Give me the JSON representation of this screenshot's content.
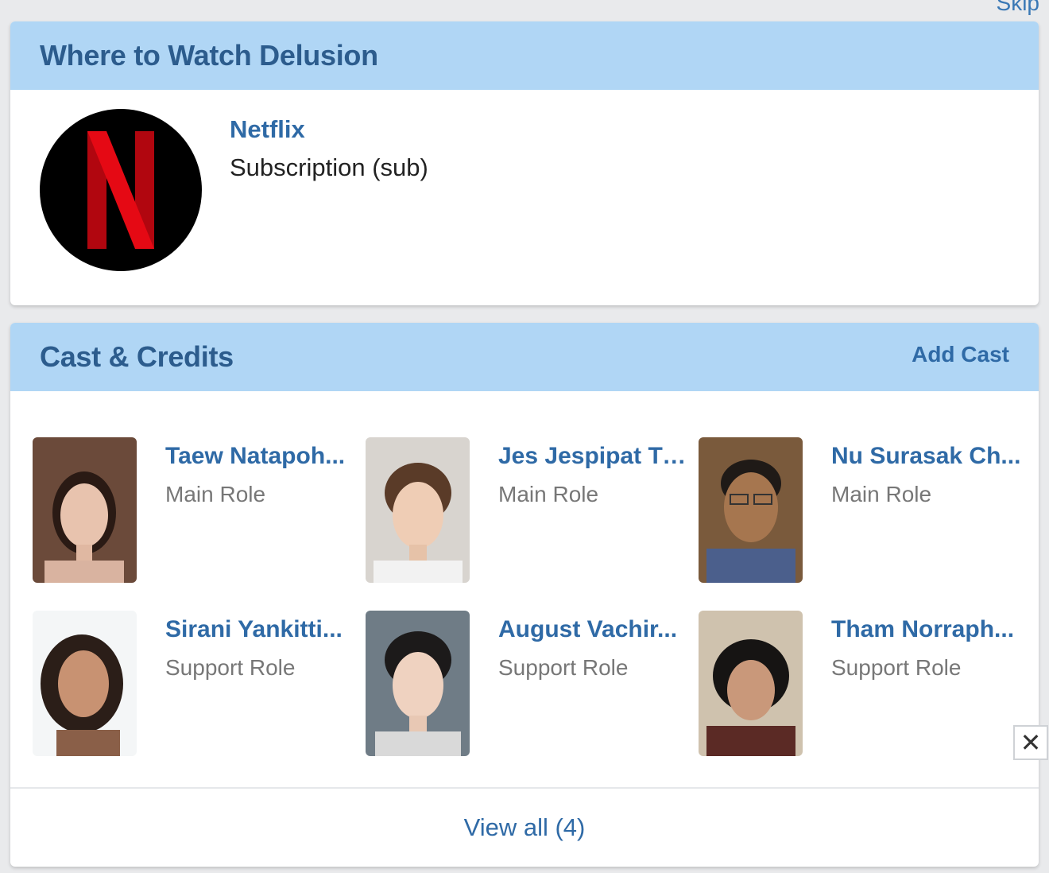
{
  "skip_label": "Skip",
  "watch": {
    "title": "Where to Watch Delusion",
    "provider": {
      "name": "Netflix",
      "type": "Subscription (sub)",
      "logo_icon": "netflix-logo-icon",
      "brand_color": "#e50914"
    }
  },
  "cast": {
    "title": "Cast & Credits",
    "add_label": "Add Cast",
    "items": [
      {
        "name": "Taew Natapoh...",
        "role": "Main Role"
      },
      {
        "name": "Jes Jespipat Til...",
        "role": "Main Role"
      },
      {
        "name": "Nu Surasak Ch...",
        "role": "Main Role"
      },
      {
        "name": "Sirani Yankitti...",
        "role": "Support Role"
      },
      {
        "name": "August Vachir...",
        "role": "Support Role"
      },
      {
        "name": "Tham Norraph...",
        "role": "Support Role"
      }
    ],
    "view_all_label": "View all (4)"
  },
  "close_label": "✕",
  "colors": {
    "header_bg": "#b0d6f5",
    "link": "#2f6aa6",
    "page_bg": "#e9eaec"
  }
}
